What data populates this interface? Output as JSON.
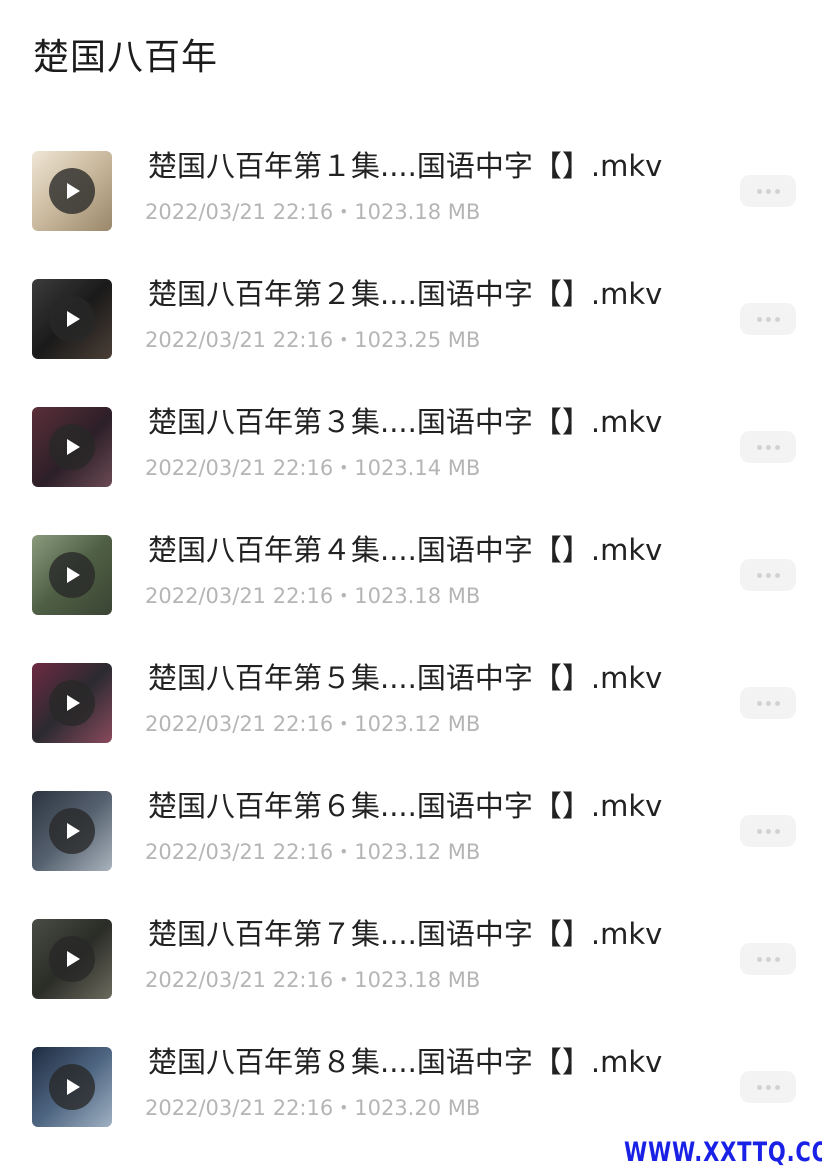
{
  "page": {
    "title": "楚国八百年"
  },
  "files": [
    {
      "name": "楚国八百年第１集....国语中字【】.mkv",
      "date": "2022/03/21 22:16",
      "size": "1023.18 MB"
    },
    {
      "name": "楚国八百年第２集....国语中字【】.mkv",
      "date": "2022/03/21 22:16",
      "size": "1023.25 MB"
    },
    {
      "name": "楚国八百年第３集....国语中字【】.mkv",
      "date": "2022/03/21 22:16",
      "size": "1023.14 MB"
    },
    {
      "name": "楚国八百年第４集....国语中字【】.mkv",
      "date": "2022/03/21 22:16",
      "size": "1023.18 MB"
    },
    {
      "name": "楚国八百年第５集....国语中字【】.mkv",
      "date": "2022/03/21 22:16",
      "size": "1023.12 MB"
    },
    {
      "name": "楚国八百年第６集....国语中字【】.mkv",
      "date": "2022/03/21 22:16",
      "size": "1023.12 MB"
    },
    {
      "name": "楚国八百年第７集....国语中字【】.mkv",
      "date": "2022/03/21 22:16",
      "size": "1023.18 MB"
    },
    {
      "name": "楚国八百年第８集....国语中字【】.mkv",
      "date": "2022/03/21 22:16",
      "size": "1023.20 MB"
    }
  ],
  "meta_separator": "・",
  "icons": {
    "thumbnail_overlay": "play-icon",
    "row_action": "more-dots-icon"
  },
  "colors": {
    "title": "#1c1c1c",
    "file_name": "#222222",
    "meta": "#b5b5b5",
    "more_button_bg": "#f3f3f3",
    "watermark": "#1a21e6"
  },
  "watermark": "WWW.XXTTQ.COM"
}
